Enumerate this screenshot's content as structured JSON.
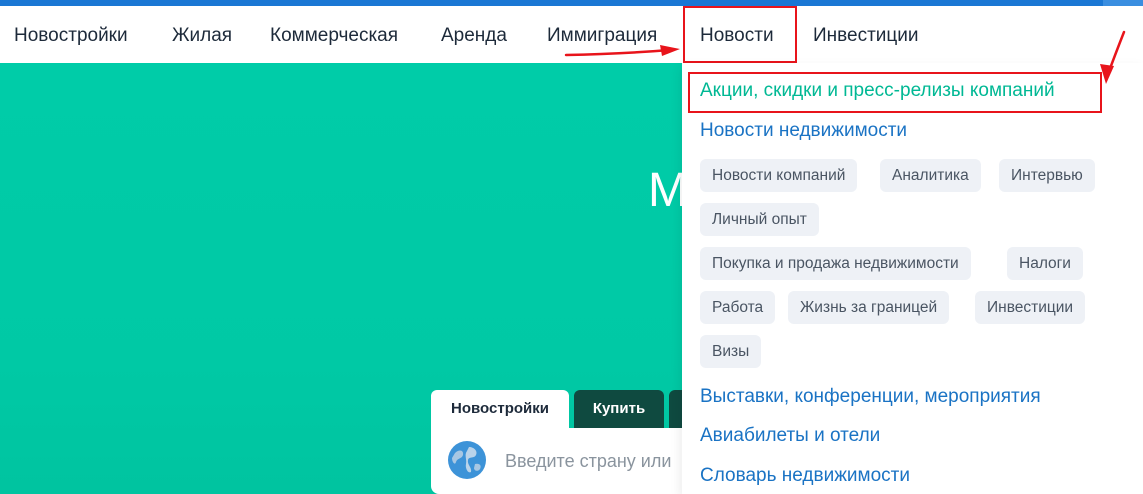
{
  "nav": {
    "items": [
      "Новостройки",
      "Жилая",
      "Коммерческая",
      "Аренда",
      "Иммиграция",
      "Новости",
      "Инвестиции"
    ]
  },
  "hero": {
    "title_fragment": "М",
    "tabs": [
      "Новостройки",
      "Купить"
    ],
    "search_placeholder": "Введите страну или"
  },
  "dropdown": {
    "promo_link": "Акции, скидки и пресс-релизы компаний",
    "news_link": "Новости недвижимости",
    "chips": [
      "Новости компаний",
      "Аналитика",
      "Интервью",
      "Личный опыт",
      "Покупка и продажа недвижимости",
      "Налоги",
      "Работа",
      "Жизнь за границей",
      "Инвестиции",
      "Визы"
    ],
    "links": [
      "Выставки, конференции, мероприятия",
      "Авиабилеты и отели",
      "Словарь недвижимости"
    ]
  },
  "colors": {
    "hero_bg": "#00cca8",
    "link_blue": "#1a73c4",
    "link_green": "#00b894",
    "highlight_red": "#e8141b",
    "tab_dark": "#0f4a40"
  },
  "icons": {
    "search_globe": "globe-icon"
  }
}
